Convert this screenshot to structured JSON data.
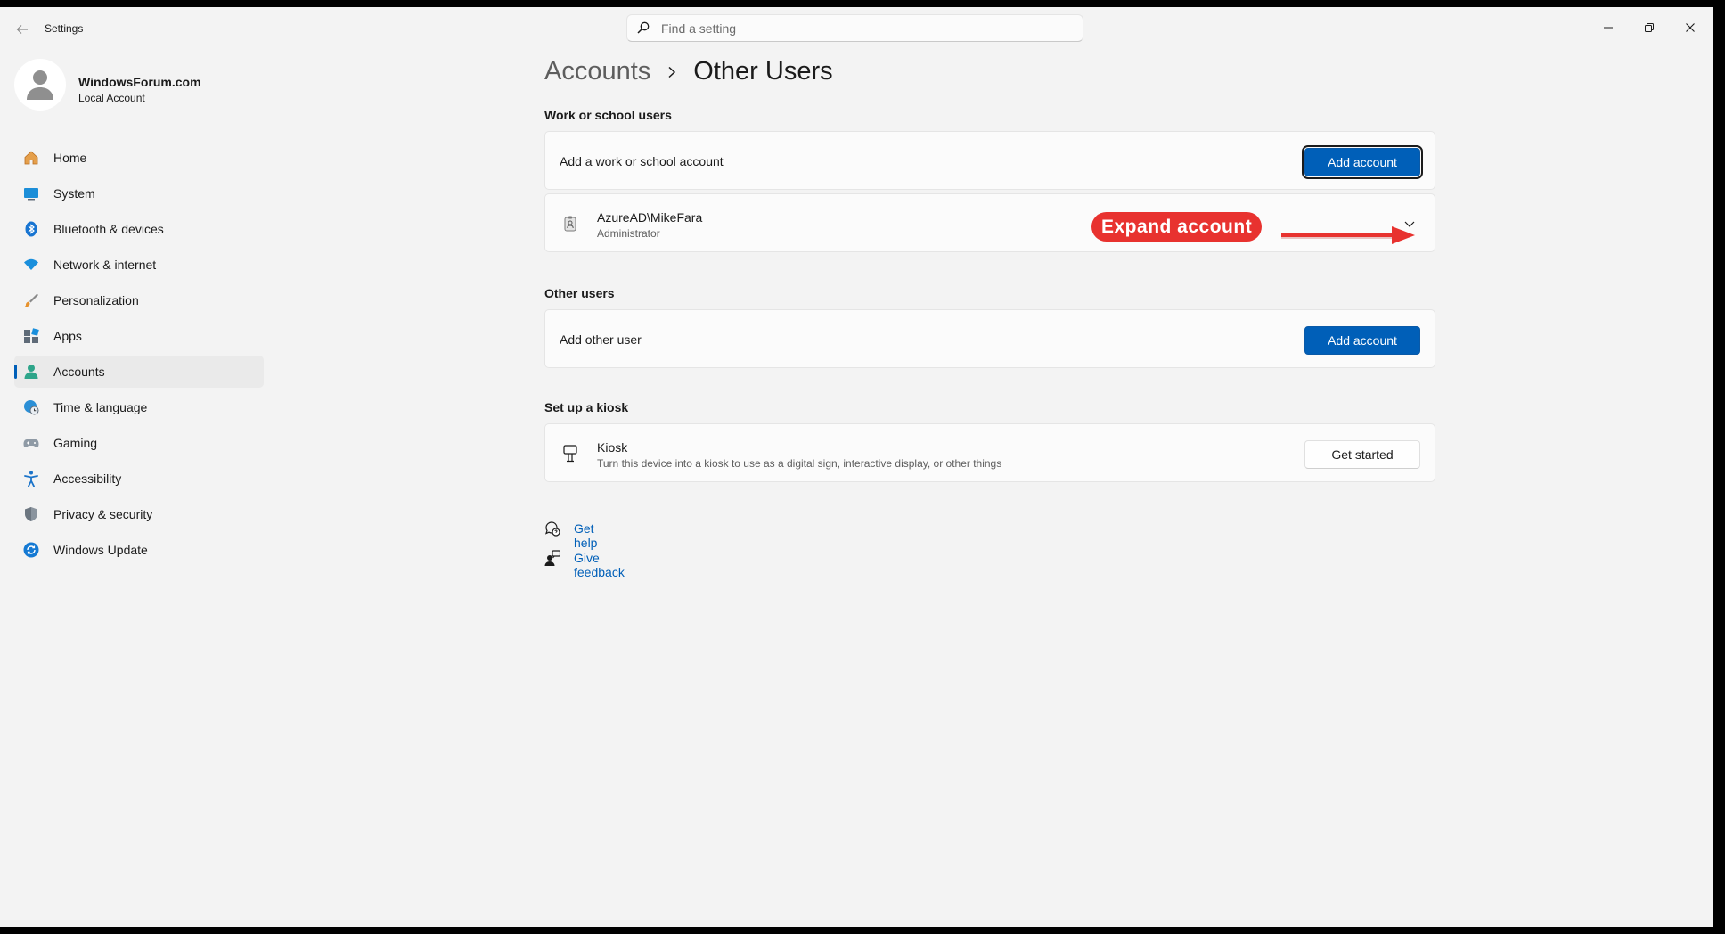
{
  "window": {
    "title": "Settings"
  },
  "search": {
    "placeholder": "Find a setting"
  },
  "profile": {
    "name": "WindowsForum.com",
    "account_type": "Local Account"
  },
  "sidebar": {
    "items": [
      {
        "label": "Home",
        "icon": "home-icon"
      },
      {
        "label": "System",
        "icon": "system-icon"
      },
      {
        "label": "Bluetooth & devices",
        "icon": "bluetooth-icon"
      },
      {
        "label": "Network & internet",
        "icon": "wifi-icon"
      },
      {
        "label": "Personalization",
        "icon": "brush-icon"
      },
      {
        "label": "Apps",
        "icon": "apps-icon"
      },
      {
        "label": "Accounts",
        "icon": "accounts-icon",
        "active": true
      },
      {
        "label": "Time & language",
        "icon": "globe-clock-icon"
      },
      {
        "label": "Gaming",
        "icon": "controller-icon"
      },
      {
        "label": "Accessibility",
        "icon": "accessibility-icon"
      },
      {
        "label": "Privacy & security",
        "icon": "shield-icon"
      },
      {
        "label": "Windows Update",
        "icon": "update-icon"
      }
    ]
  },
  "breadcrumb": {
    "parent": "Accounts",
    "current": "Other Users"
  },
  "work_school": {
    "title": "Work or school users",
    "add_label": "Add a work or school account",
    "add_button": "Add account",
    "account": {
      "name": "AzureAD\\MikeFara",
      "role": "Administrator"
    }
  },
  "annotation": {
    "text": "Expand account",
    "color": "#e8322f"
  },
  "other_users": {
    "title": "Other users",
    "add_label": "Add other user",
    "add_button": "Add account"
  },
  "kiosk": {
    "title": "Set up a kiosk",
    "name": "Kiosk",
    "description": "Turn this device into a kiosk to use as a digital sign, interactive display, or other things",
    "button": "Get started"
  },
  "links": {
    "help": "Get help",
    "feedback": "Give feedback"
  },
  "colors": {
    "accent": "#005fb8",
    "background": "#f3f3f3",
    "card": "#fbfbfb"
  }
}
